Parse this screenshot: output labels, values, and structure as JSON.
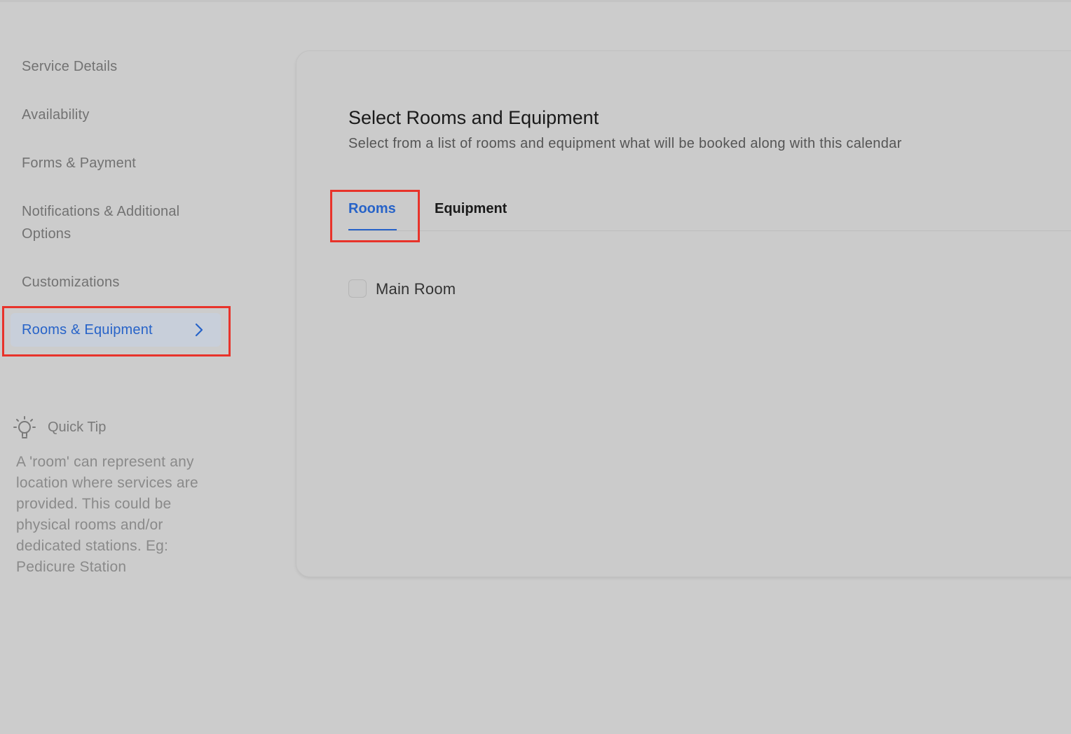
{
  "sidebar": {
    "items": [
      {
        "label": "Service Details"
      },
      {
        "label": "Availability"
      },
      {
        "label": "Forms & Payment"
      },
      {
        "label": "Notifications & Additional Options"
      },
      {
        "label": "Customizations"
      },
      {
        "label": "Rooms & Equipment",
        "active": true
      }
    ],
    "quick_tip": {
      "title": "Quick Tip",
      "body": "A 'room' can represent any location where services are provided. This could be physical rooms and/or dedicated stations. Eg: Pedicure Station",
      "icon": "lightbulb-icon"
    }
  },
  "main": {
    "title": "Select Rooms and Equipment",
    "subtitle": "Select from a list of rooms and equipment what will be booked along with this calendar",
    "tabs": [
      {
        "label": "Rooms",
        "active": true
      },
      {
        "label": "Equipment",
        "active": false
      }
    ],
    "rooms": [
      {
        "label": "Main Room",
        "checked": false
      }
    ]
  },
  "colors": {
    "accent": "#2763c8",
    "highlight_border": "#e8332a",
    "background": "#cccccc"
  }
}
